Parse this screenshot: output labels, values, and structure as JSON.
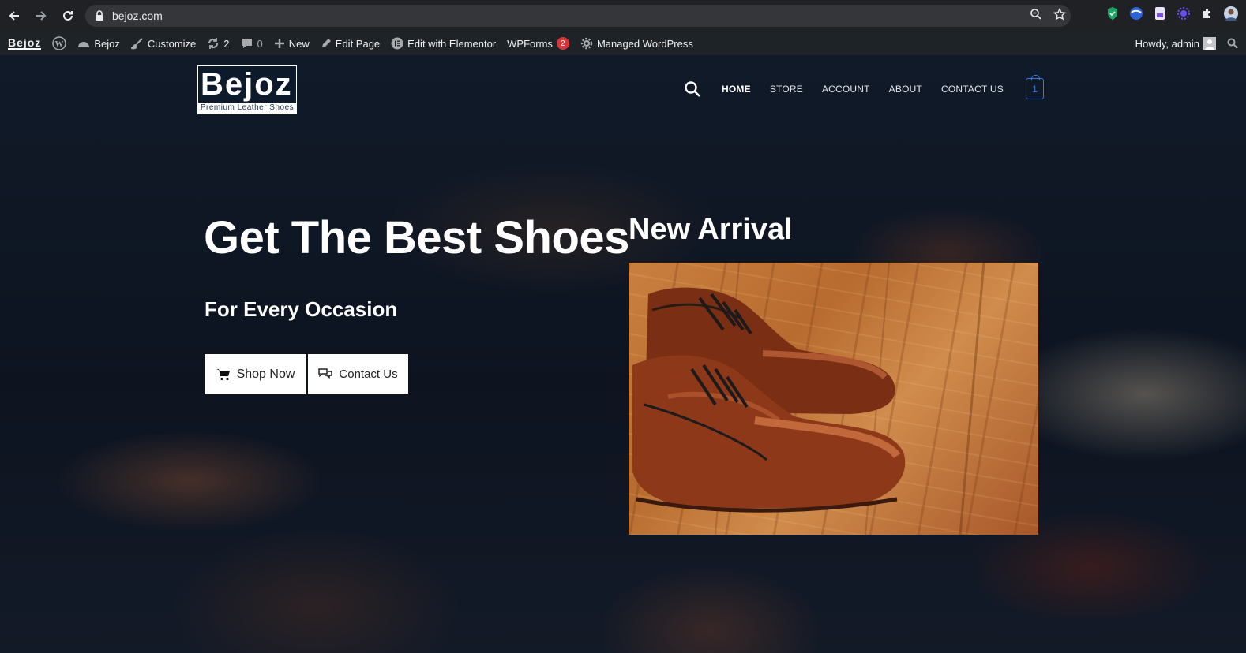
{
  "browser": {
    "url": "bejoz.com"
  },
  "wp_admin_bar": {
    "logo_text": "Bejoz",
    "site_name": "Bejoz",
    "customize": "Customize",
    "updates_count": "2",
    "comments_count": "0",
    "new": "New",
    "edit_page": "Edit Page",
    "edit_elementor": "Edit with Elementor",
    "wpforms": "WPForms",
    "wpforms_badge": "2",
    "managed_wp": "Managed WordPress",
    "howdy": "Howdy, admin"
  },
  "site": {
    "logo_text": "Bejoz",
    "logo_tagline": "Premium  Leather  Shoes",
    "nav": [
      "HOME",
      "STORE",
      "ACCOUNT",
      "ABOUT",
      "CONTACT US"
    ],
    "cart_count": "1"
  },
  "hero": {
    "headline": "Get The Best Shoes",
    "subheadline": "For Every Occasion",
    "shop_button": "Shop Now",
    "contact_button": "Contact Us",
    "arrival_title": "New Arrival"
  },
  "colors": {
    "chrome_bg": "#202124",
    "wp_bar_bg": "#1d2327",
    "cart_accent": "#3a7ad9",
    "badge": "#d63638"
  }
}
